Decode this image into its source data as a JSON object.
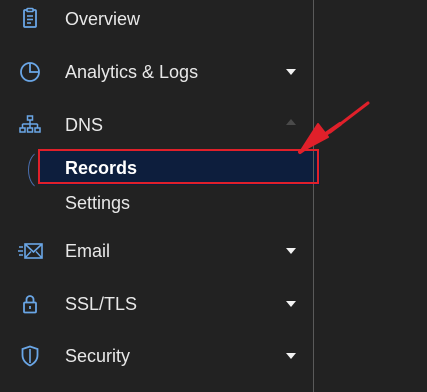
{
  "sidebar": {
    "items": [
      {
        "label": "Overview",
        "icon": "clipboard-icon",
        "has_chevron": false
      },
      {
        "label": "Analytics & Logs",
        "icon": "pie-chart-icon",
        "has_chevron": true
      },
      {
        "label": "DNS",
        "icon": "network-icon",
        "has_chevron": true,
        "expanded": true
      },
      {
        "label": "Email",
        "icon": "email-icon",
        "has_chevron": true
      },
      {
        "label": "SSL/TLS",
        "icon": "lock-icon",
        "has_chevron": true
      },
      {
        "label": "Security",
        "icon": "shield-icon",
        "has_chevron": true
      }
    ],
    "dns_subitems": [
      {
        "label": "Records",
        "active": true
      },
      {
        "label": "Settings",
        "active": false
      }
    ]
  },
  "colors": {
    "background": "#222222",
    "text": "#e8e8e8",
    "icon_blue": "#6aa6e6",
    "active_bg": "#0d1e3d",
    "annotation_red": "#e0202a"
  }
}
